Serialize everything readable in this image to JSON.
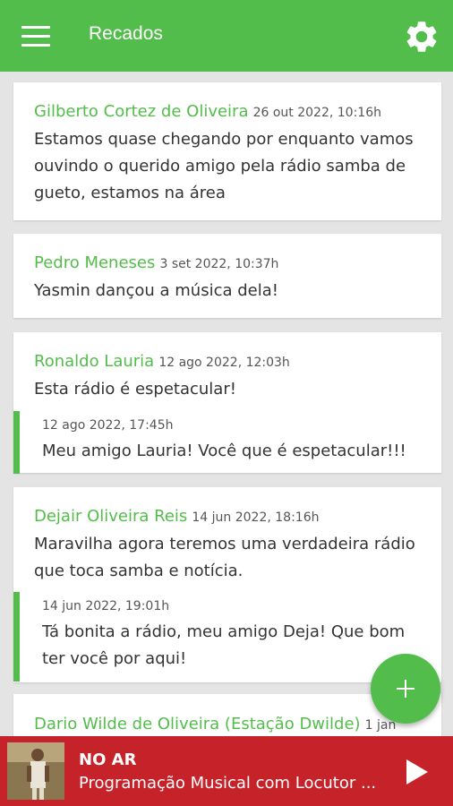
{
  "app_bar": {
    "title": "Recados",
    "menu_icon": "menu-icon",
    "settings_icon": "gear-icon",
    "color": "#53bd4b"
  },
  "messages": [
    {
      "author": "Gilberto Cortez de Oliveira",
      "time": "26 out 2022, 10:16h",
      "text": "Estamos quase chegando por enquanto vamos ouvindo o querido amigo pela rádio samba de gueto, estamos na área"
    },
    {
      "author": "Pedro Meneses",
      "time": "3 set 2022, 10:37h",
      "text": "Yasmin dançou a música dela!"
    },
    {
      "author": "Ronaldo Lauria",
      "time": "12 ago 2022, 12:03h",
      "text": "Esta rádio é espetacular!",
      "reply": {
        "time": "12 ago 2022, 17:45h",
        "text": "Meu amigo Lauria! Você que é espetacular!!!"
      }
    },
    {
      "author": "Dejair Oliveira Reis",
      "time": "14 jun 2022, 18:16h",
      "text": "Maravilha agora teremos uma verdadeira rádio que toca samba e notícia.",
      "reply": {
        "time": "14 jun 2022, 19:01h",
        "text": "Tá bonita a rádio, meu amigo Deja! Que bom ter você por aqui!"
      }
    },
    {
      "author": "Dario Wilde de Oliveira (Estação Dwilde)",
      "time": "1 jan"
    }
  ],
  "fab": {
    "icon": "plus-icon"
  },
  "player": {
    "status": "NO AR",
    "program": "Programação Musical com Locutor ...",
    "play_icon": "play-icon",
    "color": "#c62229"
  }
}
